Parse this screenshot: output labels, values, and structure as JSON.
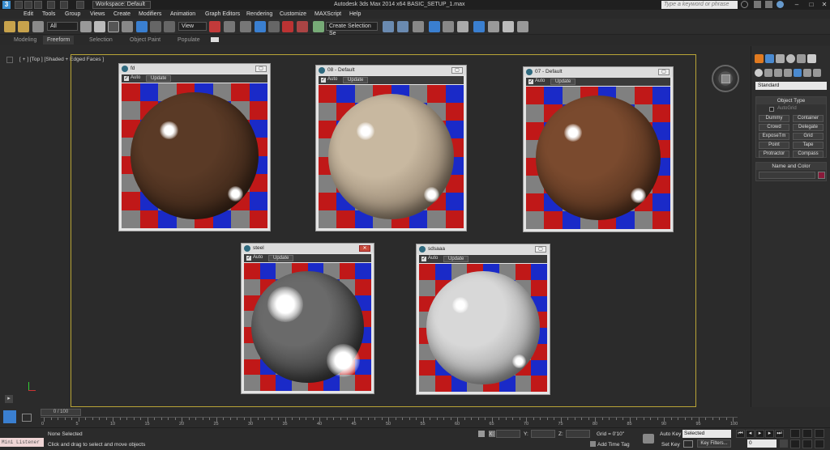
{
  "titlebar": {
    "workspace": "Workspace: Default",
    "app_title": "Autodesk 3ds Max  2014 x64     BASIC_SETUP_1.max",
    "search_placeholder": "Type a keyword or phrase",
    "window_controls": [
      "–",
      "□",
      "✕"
    ]
  },
  "menu": [
    "Edit",
    "Tools",
    "Group",
    "Views",
    "Create",
    "Modifiers",
    "Animation",
    "Graph Editors",
    "Rendering",
    "Customize",
    "MAXScript",
    "Help"
  ],
  "toolbar": {
    "selection_filter": "All",
    "ref_coord": "View",
    "named_selection": "Create Selection Se"
  },
  "ribbon": {
    "tabs": [
      "Modeling",
      "Freeform",
      "Selection",
      "Object Paint",
      "Populate"
    ],
    "active_tab": "Freeform"
  },
  "viewport": {
    "label": "[ + ] [Top ] [Shaded + Edged Faces ]"
  },
  "material_windows": [
    {
      "title": "fd",
      "auto": "Auto",
      "update": "Update",
      "sphere": "#5a3a26",
      "sphere2": "#2a1a10"
    },
    {
      "title": "08 - Default",
      "auto": "Auto",
      "update": "Update",
      "sphere": "#c8b8a0",
      "sphere2": "#6a5a4a"
    },
    {
      "title": "07 - Default",
      "auto": "Auto",
      "update": "Update",
      "sphere": "#7a4a2e",
      "sphere2": "#3a2214"
    },
    {
      "title": "steel",
      "auto": "Auto",
      "update": "Update",
      "sphere": "#6a6a6a",
      "sphere2": "#1a1a1a"
    },
    {
      "title": "sdsaaa",
      "auto": "Auto",
      "update": "Update",
      "sphere": "#d8d8d8",
      "sphere2": "#7a7a7a"
    }
  ],
  "command_panel": {
    "category": "Standard",
    "object_type_header": "Object Type",
    "autogrid": "AutoGrid",
    "buttons": [
      "Dummy",
      "Container",
      "Crowd",
      "Delegate",
      "ExposeTm",
      "Grid",
      "Point",
      "Tape",
      "Protractor",
      "Compass"
    ],
    "name_color_header": "Name and Color",
    "color_swatch": "#8a1a3a"
  },
  "timeline": {
    "slider": "0 / 100",
    "ticks": [
      "0",
      "5",
      "10",
      "15",
      "20",
      "25",
      "30",
      "35",
      "40",
      "45",
      "50",
      "55",
      "60",
      "65",
      "70",
      "75",
      "80",
      "85",
      "90",
      "95",
      "100"
    ]
  },
  "status": {
    "maxscript": "Mini Listener",
    "selection": "None Selected",
    "prompt": "Click and drag to select and move objects",
    "x_label": "X:",
    "y_label": "Y:",
    "z_label": "Z:",
    "grid": "Grid = 0'10\"",
    "add_time_tag": "Add Time Tag",
    "auto_key": "Auto Key",
    "set_key": "Set Key",
    "key_mode": "Selected",
    "key_filters": "Key Filters...",
    "frame": "0"
  }
}
